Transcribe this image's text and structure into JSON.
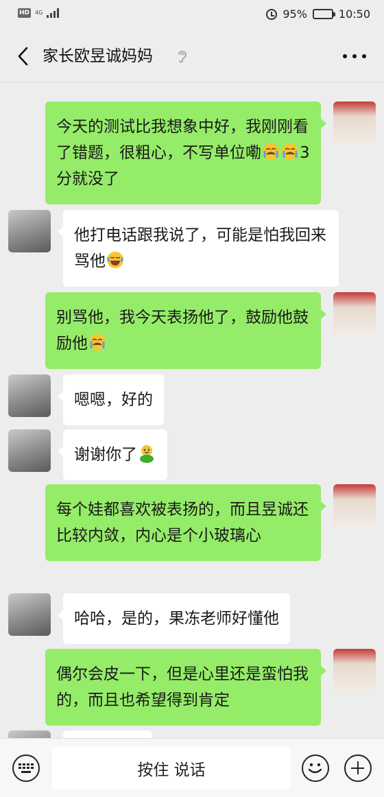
{
  "status_bar": {
    "network": "4G",
    "battery": "95%",
    "time": "10:50"
  },
  "header": {
    "title": "家长欧昱诚妈妈"
  },
  "messages": [
    {
      "side": "me",
      "text": "今天的测试比我想象中好，我刚刚看了错题，很粗心，不写单位嘞",
      "emoji": [
        "sob-emoji",
        "sob-emoji"
      ],
      "tail": "3 分就没了"
    },
    {
      "side": "other",
      "text": "他打电话跟我说了，可能是怕我回来骂他",
      "emoji": [
        "laugh-tears-emoji"
      ]
    },
    {
      "side": "me",
      "text": "别骂他，我今天表扬他了，鼓励他鼓励他",
      "emoji": [
        "sob-emoji"
      ]
    },
    {
      "side": "other",
      "text": "嗯嗯，好的"
    },
    {
      "side": "other",
      "text": "谢谢你了",
      "emoji": [
        "frog-emoji"
      ]
    },
    {
      "side": "me",
      "text": "每个娃都喜欢被表扬的，而且昱诚还比较内敛，内心是个小玻璃心"
    },
    {
      "side": "other",
      "text": "哈哈，是的，果冻老师好懂他"
    },
    {
      "side": "me",
      "text": "偶尔会皮一下，但是心里还是蛮怕我的，而且也希望得到肯定"
    }
  ],
  "input_bar": {
    "hold_to_talk": "按住 说话"
  },
  "colors": {
    "background": "#ededed",
    "my_bubble": "#95ec69",
    "other_bubble": "#ffffff"
  }
}
